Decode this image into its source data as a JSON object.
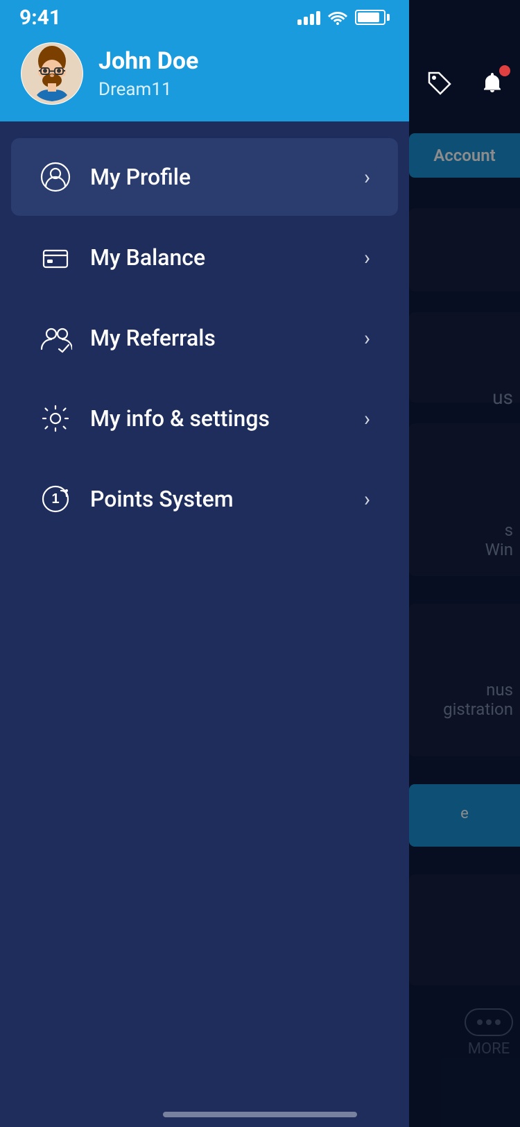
{
  "statusBar": {
    "time": "9:41",
    "signal": "signal-icon",
    "wifi": "wifi-icon",
    "battery": "battery-icon"
  },
  "header": {
    "userName": "John Doe",
    "userSubtitle": "Dream11"
  },
  "menu": {
    "items": [
      {
        "id": "my-profile",
        "label": "My Profile",
        "icon": "profile-icon",
        "active": true
      },
      {
        "id": "my-balance",
        "label": "My Balance",
        "icon": "balance-icon",
        "active": false
      },
      {
        "id": "my-referrals",
        "label": "My Referrals",
        "icon": "referrals-icon",
        "active": false
      },
      {
        "id": "my-info-settings",
        "label": "My info & settings",
        "icon": "settings-icon",
        "active": false
      },
      {
        "id": "points-system",
        "label": "Points System",
        "icon": "points-icon",
        "active": false
      }
    ]
  },
  "background": {
    "accountButton": "Account",
    "cardTexts": [
      "us",
      "s\nWin",
      "nus\nregistration",
      "e"
    ],
    "moreLabel": "MORE"
  }
}
